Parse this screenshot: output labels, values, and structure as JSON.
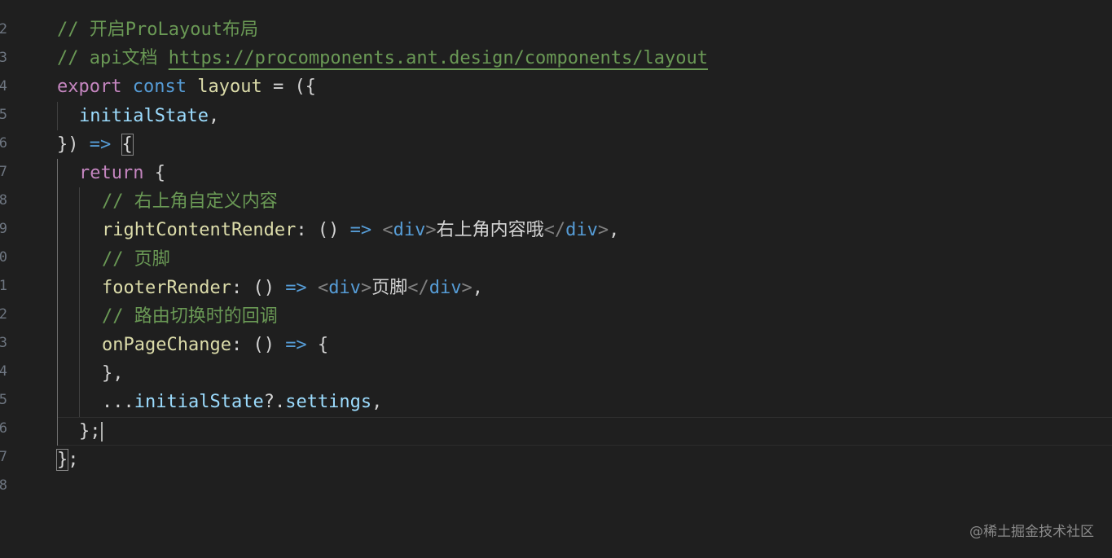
{
  "gutter": {
    "line_numbers": [
      "2",
      "3",
      "4",
      "5",
      "6",
      "7",
      "8",
      "9",
      "0",
      "1",
      "2",
      "3",
      "4",
      "5",
      "6",
      "7",
      "8"
    ]
  },
  "code": {
    "l1": {
      "comment": "// 开启ProLayout布局"
    },
    "l2": {
      "comment_prefix": "// api文档 ",
      "url": "https://procomponents.ant.design/components/layout"
    },
    "l3": {
      "kw": "export",
      "storage": "const",
      "name": "layout",
      "rest": " = ({"
    },
    "l4": {
      "param": "initialState",
      "comma": ","
    },
    "l5": {
      "close": "})",
      "arrow": "=>",
      "brace": "{"
    },
    "l6": {
      "kw": "return",
      "brace": " {"
    },
    "l7": {
      "comment": "// 右上角自定义内容"
    },
    "l8": {
      "prop": "rightContentRender",
      "colon": ": () ",
      "arrow": "=>",
      "open_lt": "<",
      "tag_open": "div",
      "gt": ">",
      "text": "右上角内容哦",
      "close_lt": "</",
      "tag_close": "div",
      "close_gt": ">",
      "end": ","
    },
    "l9": {
      "comment": "// 页脚"
    },
    "l10": {
      "prop": "footerRender",
      "colon": ": () ",
      "arrow": "=>",
      "open_lt": "<",
      "tag_open": "div",
      "gt": ">",
      "text": "页脚",
      "close_lt": "</",
      "tag_close": "div",
      "close_gt": ">",
      "end": ","
    },
    "l11": {
      "comment": "// 路由切换时的回调"
    },
    "l12": {
      "prop": "onPageChange",
      "colon": ": () ",
      "arrow": "=>",
      "brace": " {"
    },
    "l13": {
      "text": "},"
    },
    "l14": {
      "spread": "...",
      "var": "initialState",
      "opt": "?.",
      "member": "settings",
      "end": ","
    },
    "l15": {
      "text": "};"
    },
    "l16": {
      "brace": "}",
      "semi": ";"
    }
  },
  "watermark": "@稀土掘金技术社区",
  "colors": {
    "background": "#1f1f1f",
    "comment": "#6a9955",
    "keyword": "#c586c0",
    "storage": "#569cd6",
    "variable": "#9cdcfe",
    "function": "#dcdcaa"
  }
}
